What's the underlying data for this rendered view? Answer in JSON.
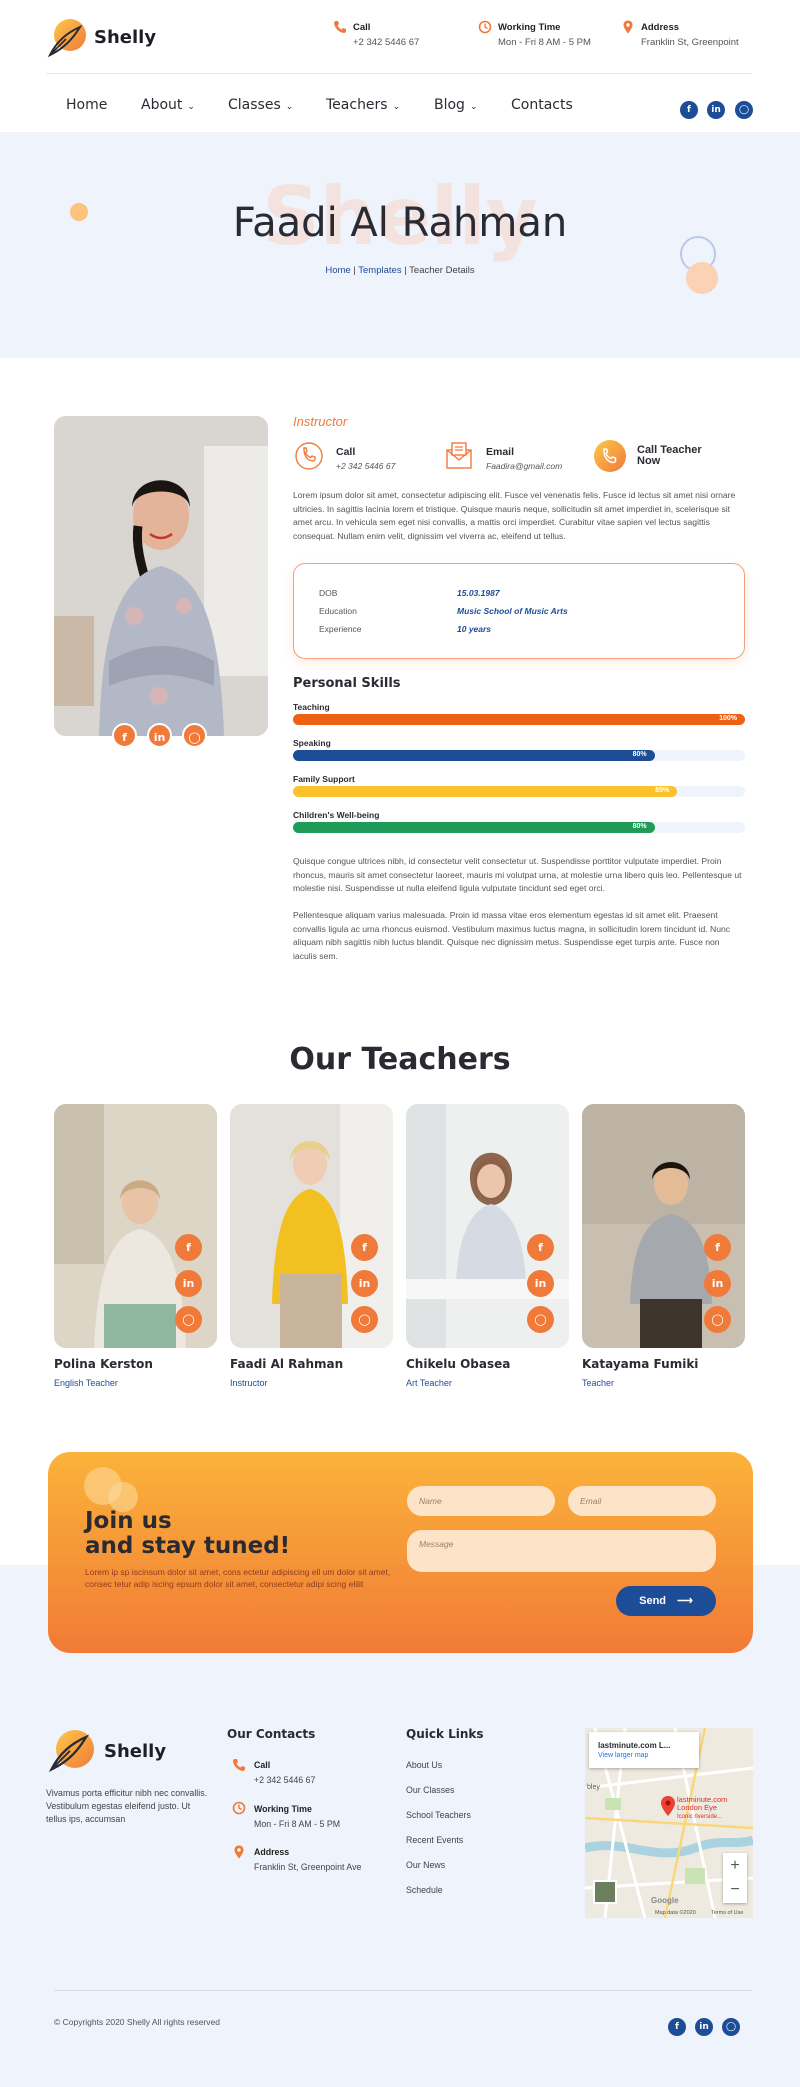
{
  "brand": {
    "name": "Shelly"
  },
  "header": {
    "contacts": [
      {
        "icon": "phone-icon",
        "title": "Call",
        "value": "+2 342 5446 67"
      },
      {
        "icon": "clock-icon",
        "title": "Working Time",
        "value": "Mon - Fri 8 AM - 5 PM"
      },
      {
        "icon": "location-pin-icon",
        "title": "Address",
        "value": "Franklin St, Greenpoint"
      }
    ],
    "nav": [
      {
        "label": "Home",
        "dropdown": false
      },
      {
        "label": "About",
        "dropdown": true
      },
      {
        "label": "Classes",
        "dropdown": true
      },
      {
        "label": "Teachers",
        "dropdown": true
      },
      {
        "label": "Blog",
        "dropdown": true
      },
      {
        "label": "Contacts",
        "dropdown": false
      }
    ],
    "social": [
      "f",
      "in",
      "ig"
    ]
  },
  "hero": {
    "bg_word": "Shelly",
    "title": "Faadi Al Rahman",
    "breadcrumb": {
      "home": "Home",
      "sep": "|",
      "templates": "Templates",
      "current": "Teacher Details"
    }
  },
  "profile": {
    "role": "Instructor",
    "contacts": [
      {
        "title": "Call",
        "value": "+2 342 5446 67"
      },
      {
        "title": "Email",
        "value": "Faadira@gmail.com"
      },
      {
        "title": "Call Teacher Now",
        "value": ""
      }
    ],
    "intro": "Lorem ipsum dolor sit amet, consectetur adipiscing elit. Fusce vel venenatis felis. Fusce id lectus sit amet nisi ornare ultricies. In sagittis lacinia lorem et tristique. Quisque mauris neque, sollicitudin sit amet imperdiet in, scelerisque sit amet arcu. In vehicula sem eget nisi convallis, a mattis orci imperdiet. Curabitur vitae sapien vel lectus sagittis consequat. Nullam enim velit, dignissim vel viverra ac, eleifend ut tellus.",
    "details": [
      {
        "label": "DOB",
        "value": "15.03.1987"
      },
      {
        "label": "Education",
        "value": "Music School of Music Arts"
      },
      {
        "label": "Experience",
        "value": "10 years"
      }
    ],
    "skills_title": "Personal Skills",
    "skills": [
      {
        "name": "Teaching",
        "percent": 100,
        "label": "100%",
        "color": "#ee6114"
      },
      {
        "name": "Speaking",
        "percent": 80,
        "label": "80%",
        "color": "#1d4d96"
      },
      {
        "name": "Family Support",
        "percent": 85,
        "label": "85%",
        "color": "#fbc22d"
      },
      {
        "name": "Children's Well-being",
        "percent": 80,
        "label": "80%",
        "color": "#1f9a58"
      }
    ],
    "para2": "Quisque congue ultrices nibh, id consectetur velit consectetur ut. Suspendisse porttitor vulputate imperdiet. Proin rhoncus, mauris sit amet consectetur laoreet, mauris mi volutpat urna, at molestie urna libero quis leo. Pellentesque ut molestie nisi. Suspendisse ut nulla eleifend ligula vulputate tincidunt sed eget orci.",
    "para3": "Pellentesque aliquam varius malesuada. Proin id massa vitae eros elementum egestas id sit amet elit. Praesent convallis ligula ac urna rhoncus euismod. Vestibulum maximus luctus magna, in sollicitudin lorem tincidunt id. Nunc aliquam nibh sagittis nibh luctus blandit. Quisque nec dignissim metus. Suspendisse eget turpis ante. Fusce non iaculis sem."
  },
  "teachers": {
    "title": "Our Teachers",
    "items": [
      {
        "name": "Polina Kerston",
        "job": "English Teacher"
      },
      {
        "name": "Faadi Al Rahman",
        "job": "Instructor"
      },
      {
        "name": "Chikelu Obasea",
        "job": "Art Teacher"
      },
      {
        "name": "Katayama Fumiki",
        "job": "Teacher"
      }
    ]
  },
  "newsletter": {
    "title": "Join us\nand stay tuned!",
    "text": "Lorem ip sp iscinsum dolor sit amet, cons ectetur adipiscing ell um dolor sit amet, consec tetur adip iscing epsum dolor sit amet, consectetur adipi scing elilit",
    "name_placeholder": "Name",
    "email_placeholder": "Email",
    "message_placeholder": "Message",
    "send_label": "Send"
  },
  "footer": {
    "about": "Vivamus porta efficitur nibh nec convallis. Vestibulum egestas eleifend justo. Ut tellus ips, accumsan",
    "contacts_title": "Our Contacts",
    "contacts": [
      {
        "title": "Call",
        "value": "+2 342 5446 67"
      },
      {
        "title": "Working Time",
        "value": "Mon - Fri 8 AM - 5 PM"
      },
      {
        "title": "Address",
        "value": "Franklin St, Greenpoint Ave"
      }
    ],
    "links_title": "Quick Links",
    "links": [
      "About Us",
      "Our Classes",
      "School Teachers",
      "Recent Events",
      "Our News",
      "Schedule"
    ],
    "map": {
      "place": "lastminute.com L...",
      "larger": "View larger map",
      "pin_label": "lastminute.com London Eye",
      "pin_sub": "Iconic riverside...",
      "area": "bley",
      "attribution": "Map data ©2020",
      "terms": "Terms of Use",
      "google": "Google"
    },
    "copyright": "© Copyrights 2020 Shelly All rights reserved"
  },
  "colors": {
    "accent": "#f07a3a",
    "brand_blue": "#1d4d96",
    "light_bg": "#eef3fc"
  }
}
